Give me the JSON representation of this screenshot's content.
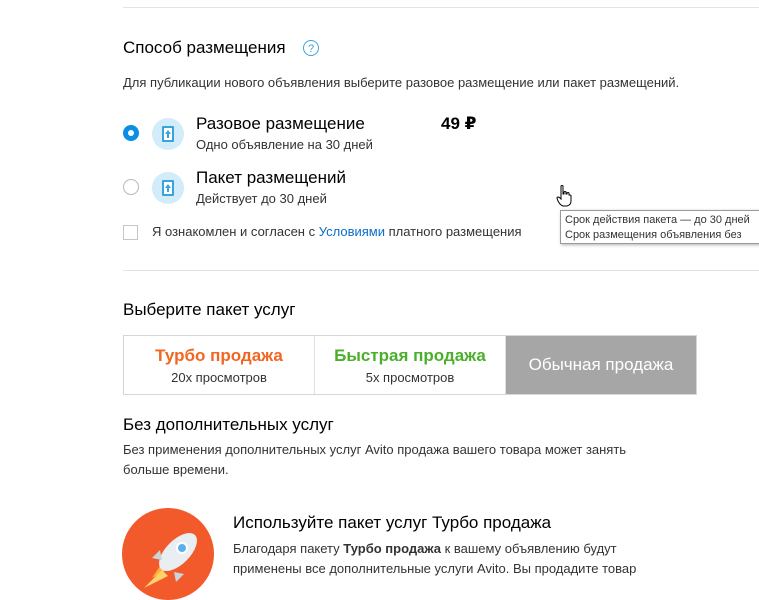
{
  "placement": {
    "title": "Способ размещения",
    "help": "?",
    "description": "Для публикации нового объявления выберите разовое размещение или пакет размещений.",
    "options": [
      {
        "title": "Разовое размещение",
        "subtitle": "Одно объявление на 30 дней",
        "price": "49 ₽",
        "selected": true
      },
      {
        "title": "Пакет размещений",
        "subtitle": "Действует до 30 дней",
        "selected": false
      }
    ],
    "agree_prefix": "Я ознакомлен и согласен с ",
    "agree_link": "Условиями",
    "agree_suffix": " платного размещения",
    "tooltip_line1": "Срок действия пакета — до 30 дней",
    "tooltip_line2": "Срок размещения объявления без"
  },
  "services": {
    "title": "Выберите пакет услуг",
    "packages": [
      {
        "name": "Турбо продажа",
        "views": "20х просмотров",
        "color": "#f26522"
      },
      {
        "name": "Быстрая продажа",
        "views": "5х просмотров",
        "color": "#4caf2c"
      },
      {
        "name": "Обычная продажа",
        "views": "",
        "color": "#ffffff"
      }
    ],
    "none_title": "Без дополнительных услуг",
    "none_desc_1": "Без применения дополнительных услуг Avito продажа вашего товара может занять",
    "none_desc_2": "больше времени."
  },
  "promo": {
    "title": "Используйте пакет услуг Турбо продажа",
    "line1_prefix": "Благодаря пакету ",
    "line1_bold": "Турбо продажа",
    "line1_suffix": " к вашему объявлению будут",
    "line2": "применены все дополнительные услуги Avito. Вы продадите товар"
  }
}
